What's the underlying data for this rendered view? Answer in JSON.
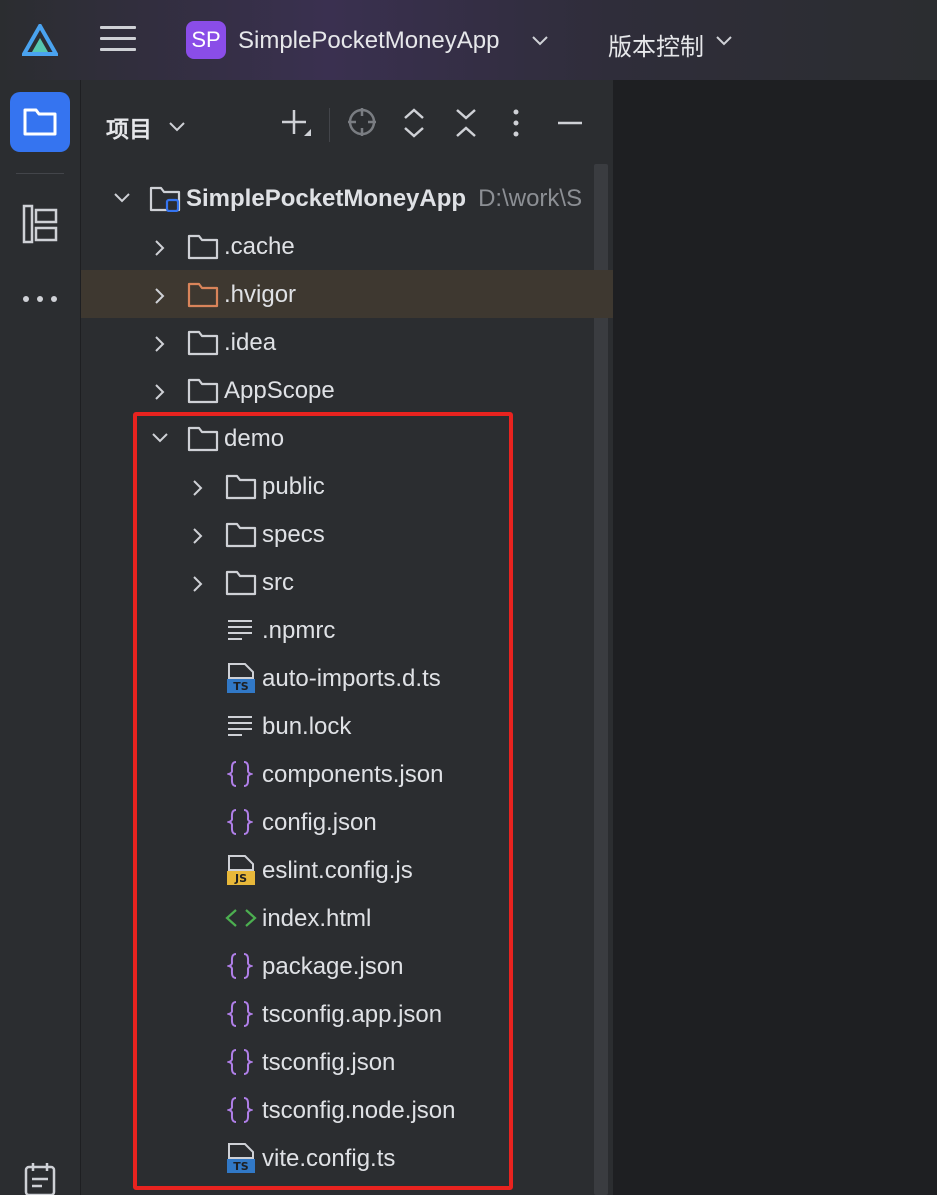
{
  "titlebar": {
    "project_badge": "SP",
    "project_name": "SimplePocketMoneyApp",
    "vcs_label": "版本控制"
  },
  "panel": {
    "title": "项目"
  },
  "tree": {
    "root": {
      "label": "SimplePocketMoneyApp",
      "path": "D:\\work\\S"
    },
    "top_folders": [
      {
        "label": ".cache",
        "icon": "folder-icon"
      },
      {
        "label": ".hvigor",
        "icon": "folder-icon"
      },
      {
        "label": ".idea",
        "icon": "folder-icon"
      },
      {
        "label": "AppScope",
        "icon": "folder-icon"
      }
    ],
    "demo": {
      "label": "demo",
      "folders": [
        {
          "label": "public"
        },
        {
          "label": "specs"
        },
        {
          "label": "src"
        }
      ],
      "files": [
        {
          "label": ".npmrc",
          "icon": "text-file-icon"
        },
        {
          "label": "auto-imports.d.ts",
          "icon": "typescript-file-icon"
        },
        {
          "label": "bun.lock",
          "icon": "text-file-icon"
        },
        {
          "label": "components.json",
          "icon": "json-file-icon"
        },
        {
          "label": "config.json",
          "icon": "json-file-icon"
        },
        {
          "label": "eslint.config.js",
          "icon": "javascript-file-icon"
        },
        {
          "label": "index.html",
          "icon": "html-file-icon"
        },
        {
          "label": "package.json",
          "icon": "json-file-icon"
        },
        {
          "label": "tsconfig.app.json",
          "icon": "json-file-icon"
        },
        {
          "label": "tsconfig.json",
          "icon": "json-file-icon"
        },
        {
          "label": "tsconfig.node.json",
          "icon": "json-file-icon"
        },
        {
          "label": "vite.config.ts",
          "icon": "typescript-file-icon"
        }
      ]
    }
  },
  "colors": {
    "accent": "#3574f0",
    "highlight_box": "#e8231f",
    "project_badge": "#8a4de8",
    "json_icon": "#b07fe8",
    "html_icon": "#4caf50",
    "ts_icon": "#3178c6",
    "js_icon": "#e8b83a"
  }
}
